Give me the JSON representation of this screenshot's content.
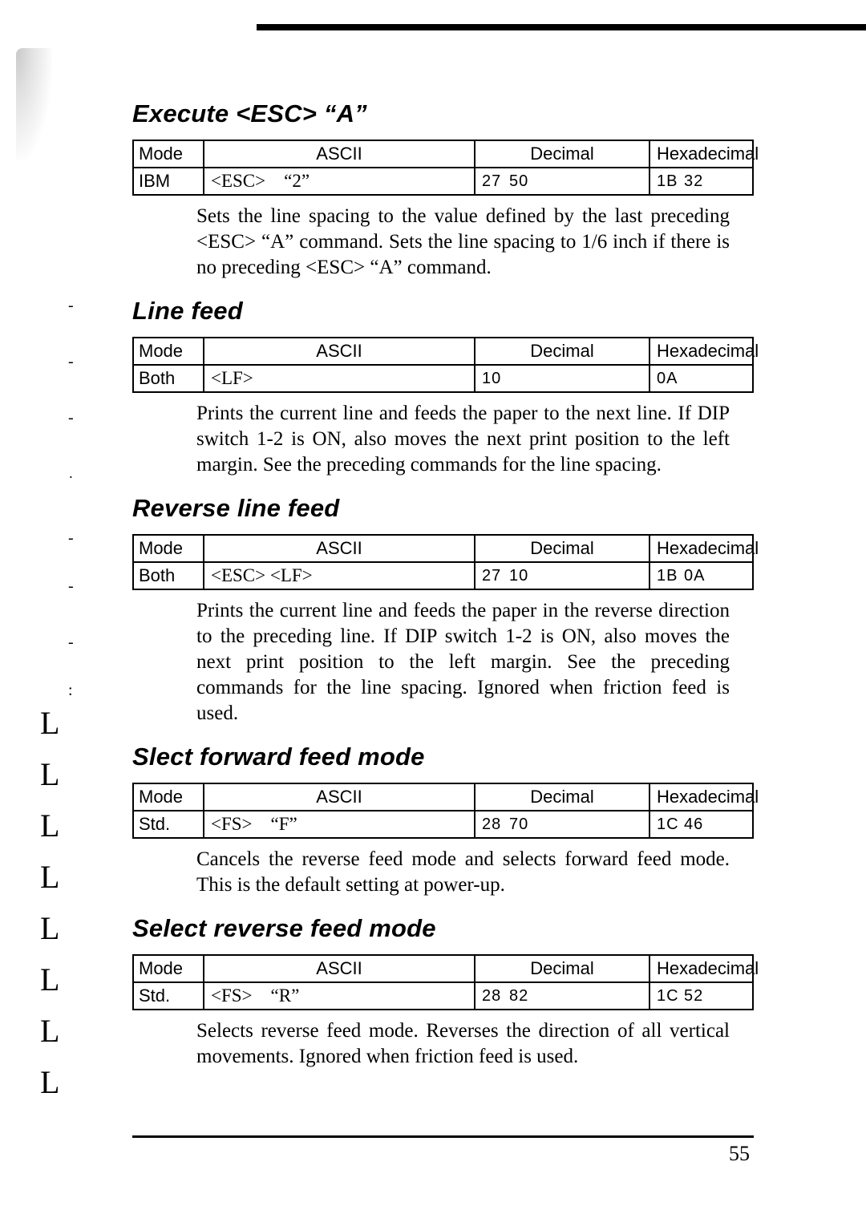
{
  "page_number": "55",
  "columns": {
    "mode": "Mode",
    "ascii": "ASCII",
    "decimal": "Decimal",
    "hex": "Hexadecimal"
  },
  "commands": [
    {
      "title": "Execute <ESC> “A”",
      "row": {
        "mode": "IBM",
        "ascii": "<ESC> “2”",
        "dec1": "27",
        "dec2": "50",
        "hex1": "1B",
        "hex2": "32"
      },
      "desc": "Sets the line spacing to the value defined by the last preceding <ESC> “A” command. Sets the line spacing to 1/6 inch if there is no preceding <ESC> “A” command."
    },
    {
      "title": "Line feed",
      "row": {
        "mode": "Both",
        "ascii": "<LF>",
        "dec1": "10",
        "dec2": "",
        "hex1": "0A",
        "hex2": ""
      },
      "desc": "Prints the current line and feeds the paper to the next line. If DIP switch 1-2 is ON, also moves the next print position to the left margin. See the preceding commands for the line spacing."
    },
    {
      "title": "Reverse line feed",
      "row": {
        "mode": "Both",
        "ascii": "<ESC> <LF>",
        "dec1": "27",
        "dec2": "10",
        "hex1": "1B",
        "hex2": "0A"
      },
      "desc": "Prints the current line and feeds the paper in the reverse direction to the preceding line. If DIP switch 1-2 is ON, also moves the next print position to the left margin. See the preceding commands for the line spacing. Ignored when friction feed is used."
    },
    {
      "title": "Slect forward feed mode",
      "row": {
        "mode": "Std.",
        "ascii": "<FS> “F”",
        "dec1": "28",
        "dec2": "70",
        "hex1": "1C",
        "hex2": "46"
      },
      "desc": "Cancels the reverse feed mode and selects forward feed mode. This is the default setting at power-up."
    },
    {
      "title": "Select reverse feed mode",
      "row": {
        "mode": "Std.",
        "ascii": "<FS> “R”",
        "dec1": "28",
        "dec2": "82",
        "hex1": "1C",
        "hex2": "52"
      },
      "desc": "Selects reverse feed mode. Reverses the direction of all vertical movements. Ignored when friction feed is used."
    }
  ]
}
